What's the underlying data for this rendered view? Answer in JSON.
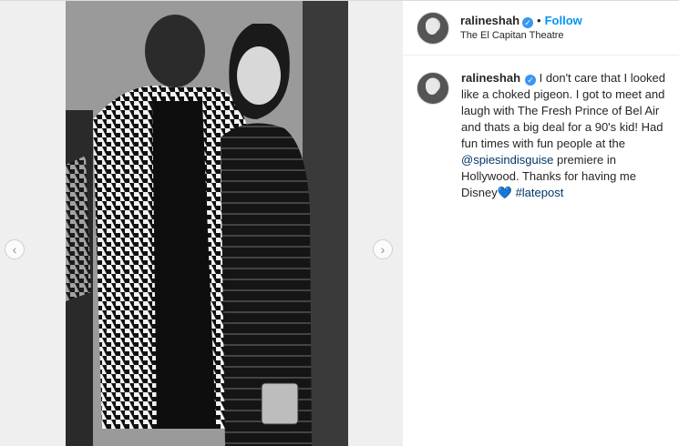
{
  "post": {
    "username": "ralineshah",
    "follow_label": "Follow",
    "separator": "•",
    "location": "The El Capitan Theatre",
    "caption": {
      "part1": "I don't care that I looked like a choked pigeon. I got to meet and laugh with The Fresh Prince of Bel Air and thats a big deal for a 90's kid! Had fun times with fun people at the",
      "mention": "@spiesindisguise",
      "part2": "premiere in Hollywood. Thanks for having me Disney",
      "emoji": "💙",
      "hashtag": "#latepost"
    }
  },
  "icons": {
    "verified": "verified-badge-icon",
    "prev": "chevron-left-icon",
    "next": "chevron-right-icon"
  },
  "nav": {
    "prev_glyph": "‹",
    "next_glyph": "›"
  },
  "colors": {
    "follow": "#0095f6",
    "verified": "#3897f0",
    "link": "#00376b"
  }
}
